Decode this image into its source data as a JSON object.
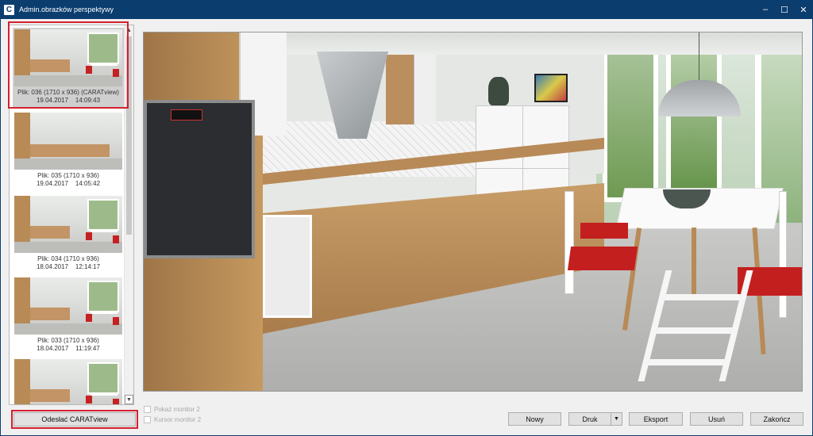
{
  "window": {
    "app_icon": "C",
    "title": "Admin.obrazków perspektywy",
    "minimize_glyph": "–",
    "maximize_glyph": "☐",
    "close_glyph": "✕"
  },
  "thumbnails": [
    {
      "file": "Plik: 036 (1710 x 936) (CARATview)",
      "date": "19.04.2017",
      "time": "14:09:43",
      "selected": true
    },
    {
      "file": "Plik: 035 (1710 x 936)",
      "date": "19.04.2017",
      "time": "14:05:42",
      "selected": false
    },
    {
      "file": "Plik: 034 (1710 x 936)",
      "date": "18.04.2017",
      "time": "12:14:17",
      "selected": false
    },
    {
      "file": "Plik: 033 (1710 x 936)",
      "date": "18.04.2017",
      "time": "11:19:47",
      "selected": false
    }
  ],
  "scroll": {
    "up_glyph": "▲",
    "down_glyph": "▼"
  },
  "checkboxes": {
    "show_monitor2": "Pokaż monitor 2",
    "cursor_monitor2": "Kursor monitor 2"
  },
  "buttons": {
    "send_caratview": "Odesłać CARATview",
    "new": "Nowy",
    "print": "Druk",
    "print_arrow": "▼",
    "export": "Eksport",
    "delete": "Usuń",
    "close": "Zakończ"
  },
  "colors": {
    "titlebar": "#0b3d6f",
    "highlight_frame": "#d42030"
  }
}
